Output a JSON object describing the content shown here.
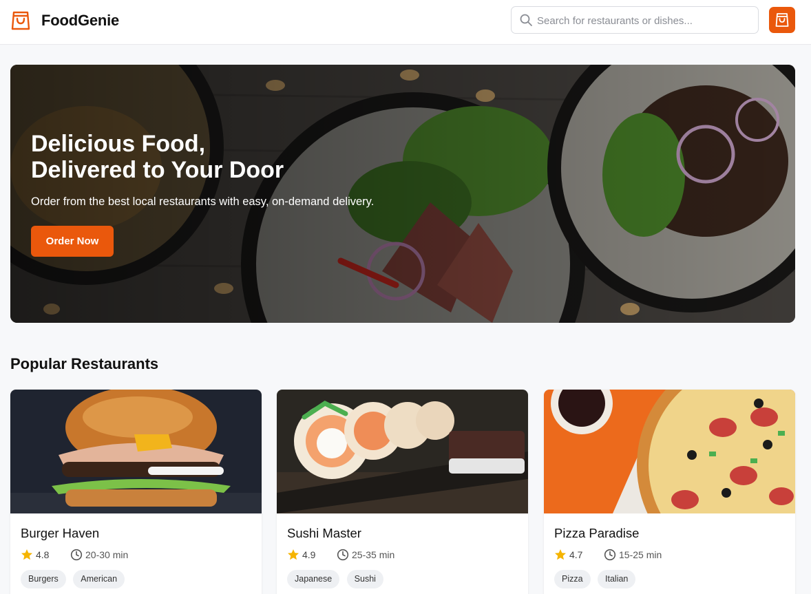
{
  "header": {
    "brand": "FoodGenie",
    "search_placeholder": "Search for restaurants or dishes...",
    "accent": "#ea580c"
  },
  "hero": {
    "title_line1": "Delicious Food,",
    "title_line2": "Delivered to Your Door",
    "subtitle": "Order from the best local restaurants with easy, on-demand delivery.",
    "button_label": "Order Now"
  },
  "popular": {
    "title": "Popular Restaurants",
    "restaurants": [
      {
        "name": "Burger Haven",
        "rating": "4.8",
        "time": "20-30 min",
        "tags": [
          "Burgers",
          "American"
        ],
        "image_icon": "burger-image"
      },
      {
        "name": "Sushi Master",
        "rating": "4.9",
        "time": "25-35 min",
        "tags": [
          "Japanese",
          "Sushi"
        ],
        "image_icon": "sushi-image"
      },
      {
        "name": "Pizza Paradise",
        "rating": "4.7",
        "time": "15-25 min",
        "tags": [
          "Pizza",
          "Italian"
        ],
        "image_icon": "pizza-image"
      }
    ]
  }
}
